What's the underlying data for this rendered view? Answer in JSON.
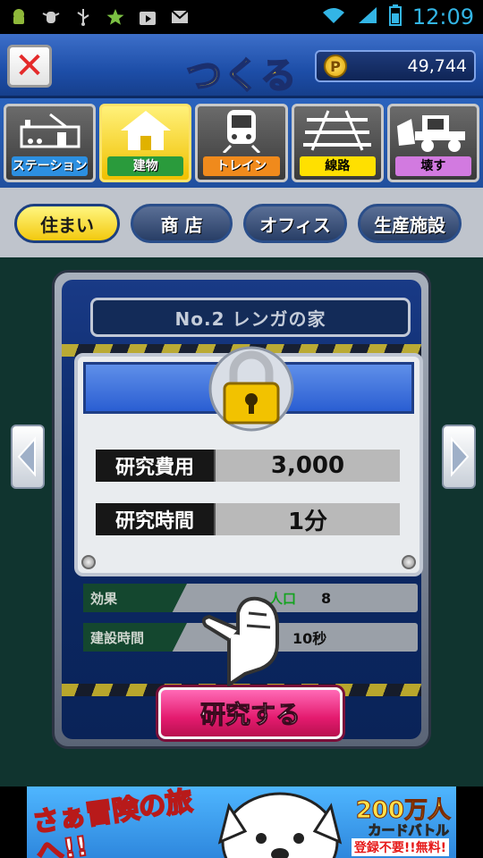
{
  "status_bar": {
    "time": "12:09",
    "icons": [
      "android-icon",
      "bug-icon",
      "usb-icon",
      "star-icon",
      "play-store-icon",
      "gmail-icon"
    ],
    "right_icons": [
      "wifi-icon",
      "signal-icon",
      "battery-icon"
    ]
  },
  "header": {
    "title": "つくる",
    "coin_symbol": "P",
    "coins": "49,744",
    "close_icon": "close-icon"
  },
  "categories": [
    {
      "label": "ステーション",
      "icon": "station-icon",
      "active": false
    },
    {
      "label": "建物",
      "icon": "house-icon",
      "active": true
    },
    {
      "label": "トレイン",
      "icon": "train-icon",
      "active": false
    },
    {
      "label": "線路",
      "icon": "railway-icon",
      "active": false
    },
    {
      "label": "壊す",
      "icon": "bulldozer-icon",
      "active": false
    }
  ],
  "subtabs": [
    {
      "label": "住まい",
      "active": true
    },
    {
      "label": "商 店",
      "active": false
    },
    {
      "label": "オフィス",
      "active": false
    },
    {
      "label": "生産施設",
      "active": false
    }
  ],
  "building": {
    "name": "No.2 レンガの家",
    "locked": true,
    "research_cost_label": "研究費用",
    "research_cost": "3,000",
    "research_time_label": "研究時間",
    "research_time": "1分",
    "effect_label": "効果",
    "effect_key": "人口",
    "effect_value": "8",
    "build_time_label": "建設時間",
    "build_time": "10秒",
    "research_button": "研究する"
  },
  "ad": {
    "left_text": "さぁ冒険の旅へ!!",
    "right_big": "200万人",
    "right_mid": "カードバトル",
    "right_small": "登録不要!!無料!"
  },
  "colors": {
    "accent_blue": "#1d4ea8",
    "active_yellow": "#f0c000",
    "button_pink": "#e41b6f",
    "background": "#10342f"
  }
}
